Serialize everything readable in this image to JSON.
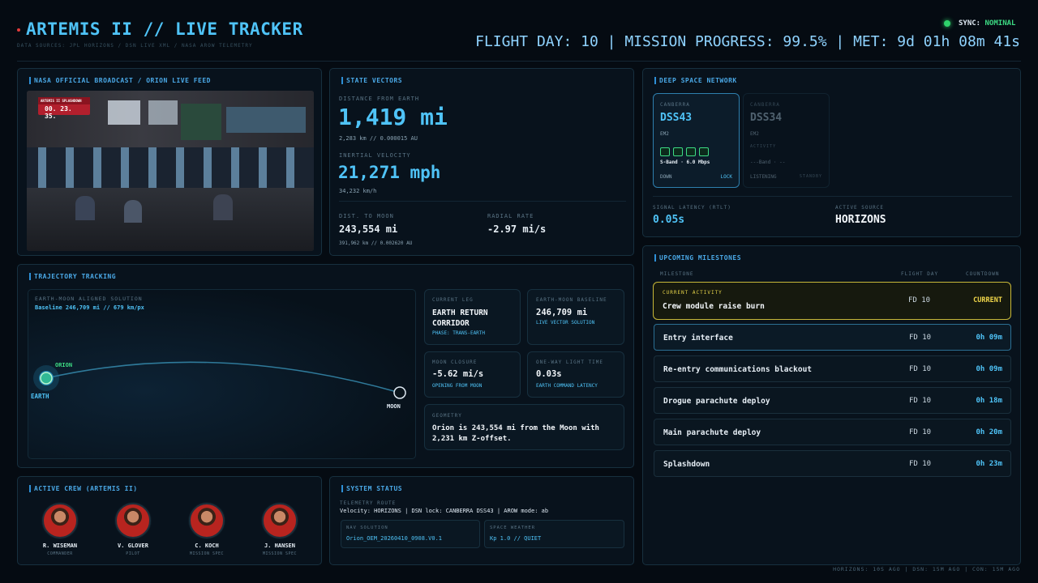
{
  "header": {
    "title": "ARTEMIS II // LIVE TRACKER",
    "sources": "DATA SOURCES: JPL HORIZONS / DSN LIVE XML / NASA AROW TELEMETRY",
    "sync_label": "SYNC:",
    "sync_status": "NOMINAL",
    "status_line": "FLIGHT DAY: 10 | MISSION PROGRESS: 99.5% | MET: 9d 01h 08m 41s"
  },
  "broadcast": {
    "title": "NASA OFFICIAL BROADCAST / ORION LIVE FEED",
    "overlay_label": "ARTEMIS II SPLASHDOWN",
    "overlay_time": "00. 23. 35."
  },
  "state": {
    "title": "STATE VECTORS",
    "dist_label": "DISTANCE FROM EARTH",
    "dist_value": "1,419 mi",
    "dist_sub": "2,283 km // 0.000015 AU",
    "vel_label": "INERTIAL VELOCITY",
    "vel_value": "21,271 mph",
    "vel_sub": "34,232 km/h",
    "moon_label": "DIST. TO MOON",
    "moon_value": "243,554 mi",
    "moon_sub": "391,962 km // 0.002620 AU",
    "radial_label": "RADIAL RATE",
    "radial_value": "-2.97 mi/s"
  },
  "dsn": {
    "title": "DEEP SPACE NETWORK",
    "s1": {
      "site": "CANBERRA",
      "dish": "DSS43",
      "target": "EM2",
      "band": "S-Band · 6.0 Mbps",
      "dir": "DOWN",
      "state": "LOCK"
    },
    "s2": {
      "site": "CANBERRA",
      "dish": "DSS34",
      "target": "EM2",
      "activity": "ACTIVITY",
      "band": "---Band · --",
      "dir": "LISTENING",
      "state": "STANDBY"
    },
    "latency_label": "SIGNAL LATENCY (RTLT)",
    "latency_value": "0.05s",
    "source_label": "ACTIVE SOURCE",
    "source_value": "HORIZONS"
  },
  "traj": {
    "title": "TRAJECTORY TRACKING",
    "solution_label": "EARTH-MOON ALIGNED SOLUTION",
    "baseline": "Baseline 246,709 mi // 679 km/px",
    "orion": "ORION",
    "earth": "EARTH",
    "moon": "MOON",
    "leg_label": "CURRENT LEG",
    "leg_value": "EARTH RETURN CORRIDOR",
    "leg_sub": "PHASE: TRANS-EARTH",
    "base_label": "EARTH-MOON BASELINE",
    "base_value": "246,709 mi",
    "base_sub": "LIVE VECTOR SOLUTION",
    "closure_label": "MOON CLOSURE",
    "closure_value": "-5.62 mi/s",
    "closure_sub": "OPENING FROM MOON",
    "light_label": "ONE-WAY LIGHT TIME",
    "light_value": "0.03s",
    "light_sub": "EARTH COMMAND LATENCY",
    "geo_label": "GEOMETRY",
    "geo_text": "Orion is 243,554 mi from the Moon with 2,231 km Z-offset."
  },
  "milestones": {
    "title": "UPCOMING MILESTONES",
    "col1": "MILESTONE",
    "col2": "FLIGHT DAY",
    "col3": "COUNTDOWN",
    "current_label": "CURRENT ACTIVITY",
    "current_name": "Crew module raise burn",
    "current_fd": "FD 10",
    "current_cd": "CURRENT",
    "items": [
      {
        "name": "Entry interface",
        "fd": "FD 10",
        "cd": "0h 09m"
      },
      {
        "name": "Re-entry communications blackout",
        "fd": "FD 10",
        "cd": "0h 09m"
      },
      {
        "name": "Drogue parachute deploy",
        "fd": "FD 10",
        "cd": "0h 18m"
      },
      {
        "name": "Main parachute deploy",
        "fd": "FD 10",
        "cd": "0h 20m"
      },
      {
        "name": "Splashdown",
        "fd": "FD 10",
        "cd": "0h 23m"
      }
    ]
  },
  "crew": {
    "title": "ACTIVE CREW (ARTEMIS II)",
    "members": [
      {
        "name": "R. WISEMAN",
        "role": "COMMANDER"
      },
      {
        "name": "V. GLOVER",
        "role": "PILOT"
      },
      {
        "name": "C. KOCH",
        "role": "MISSION SPEC"
      },
      {
        "name": "J. HANSEN",
        "role": "MISSION SPEC"
      }
    ]
  },
  "system": {
    "title": "SYSTEM STATUS",
    "route_label": "TELEMETRY ROUTE",
    "route_text": "Velocity: HORIZONS | DSN lock: CANBERRA DSS43 | AROW mode: ab",
    "nav_label": "NAV SOLUTION",
    "nav_value": "Orion_OEM_20260410_0908.V0.1",
    "wx_label": "SPACE WEATHER",
    "wx_value": "Kp 1.0 // QUIET"
  },
  "footer": "HORIZONS: 10S AGO | DSN: 15M AGO | CON: 15M AGO"
}
